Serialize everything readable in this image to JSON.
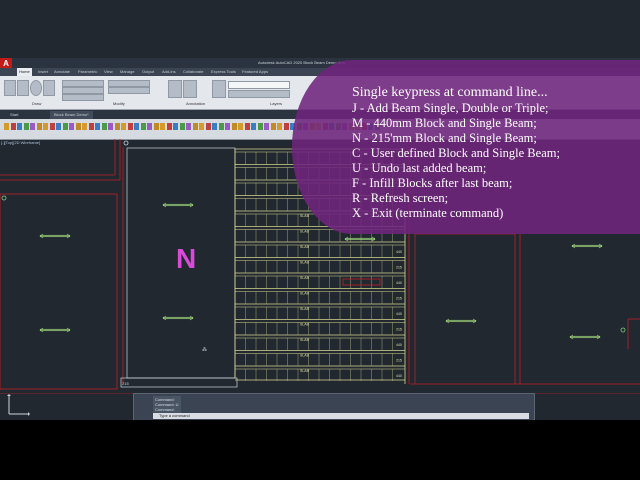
{
  "app": {
    "title": "Autodesk AutoCAD 2020   Block Beam Demo.dwg",
    "logo": "A",
    "brand_color": "#c11b17"
  },
  "ribbon": {
    "tabs": [
      "Home",
      "Insert",
      "Annotate",
      "Parametric",
      "View",
      "Manage",
      "Output",
      "Add-ins",
      "Collaborate",
      "Express Tools",
      "Featured Apps"
    ],
    "active_tab": "Home",
    "panels": [
      "Draw",
      "Modify",
      "Annotation",
      "Layers"
    ]
  },
  "file_tabs": [
    "Start",
    "Block Beam Demo*"
  ],
  "viewport": {
    "label": "[-][Top][2D Wireframe]"
  },
  "drawing": {
    "north_label": "N",
    "slab_label": "SLAB",
    "dim_215": "215",
    "dim_440": "440"
  },
  "command_line": {
    "history": [
      "Command:",
      "Command: U",
      "Command:"
    ],
    "input": "Type a command"
  },
  "overlay": {
    "heading": "Single keypress at command line...",
    "lines": [
      "J -   Add Beam Single, Double or Triple;",
      "M - 440mm Block and Single Beam;",
      "N -  215'mm Block and Single Beam;",
      "C -  User defined Block and Single Beam;",
      "U -  Undo last added beam;",
      "F -    Infill Blocks after last beam;",
      "R -  Refresh screen;",
      "X -     Exit (terminate command)"
    ],
    "color": "#70247c"
  },
  "colors": {
    "background": "#212830",
    "wall_red": "#c0202a",
    "beam_yellow": "#d8d890",
    "arrow_green": "#9fd67a"
  }
}
